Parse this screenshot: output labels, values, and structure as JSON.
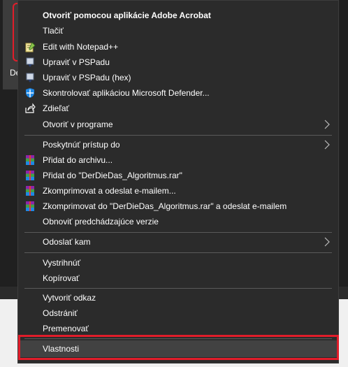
{
  "desktop": {
    "file_label": "De"
  },
  "menu": {
    "items": [
      {
        "label": "Otvoriť pomocou aplikácie Adobe Acrobat",
        "icon": "none"
      },
      {
        "label": "Tlačiť",
        "icon": "none"
      },
      {
        "label": "Edit with Notepad++",
        "icon": "notepad-icon"
      },
      {
        "label": "Upraviť v PSPadu",
        "icon": "pspad-icon"
      },
      {
        "label": "Upraviť v PSPadu (hex)",
        "icon": "pspad-icon"
      },
      {
        "label": "Skontrolovať aplikáciou Microsoft Defender...",
        "icon": "defender-shield-icon"
      },
      {
        "label": "Zdieľať",
        "icon": "share-icon"
      },
      {
        "label": "Otvoriť v programe",
        "icon": "none",
        "submenu": true
      },
      {
        "label": "Poskytnúť prístup do",
        "icon": "none",
        "submenu": true
      },
      {
        "label": "Přidat do archivu...",
        "icon": "winrar-icon"
      },
      {
        "label": "Přidat do \"DerDieDas_Algoritmus.rar\"",
        "icon": "winrar-icon"
      },
      {
        "label": "Zkomprimovat a odeslat e-mailem...",
        "icon": "winrar-icon"
      },
      {
        "label": "Zkomprimovat do \"DerDieDas_Algoritmus.rar\" a odeslat e-mailem",
        "icon": "winrar-icon"
      },
      {
        "label": "Obnoviť predchádzajúce verzie",
        "icon": "none"
      },
      {
        "label": "Odoslať kam",
        "icon": "none",
        "submenu": true
      },
      {
        "label": "Vystrihnúť",
        "icon": "none"
      },
      {
        "label": "Kopírovať",
        "icon": "none"
      },
      {
        "label": "Vytvoriť odkaz",
        "icon": "none"
      },
      {
        "label": "Odstrániť",
        "icon": "none"
      },
      {
        "label": "Premenovať",
        "icon": "none"
      },
      {
        "label": "Vlastnosti",
        "icon": "none",
        "highlighted": true
      }
    ]
  },
  "colors": {
    "menu_bg": "#2b2b2b",
    "highlight_border": "#e11d2a",
    "hover_bg": "#424242",
    "separator": "#5a5a5a"
  }
}
